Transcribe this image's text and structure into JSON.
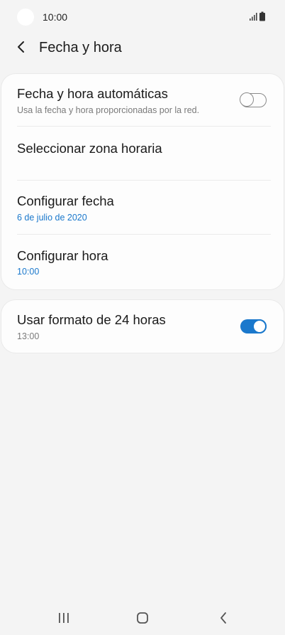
{
  "status_bar": {
    "time": "10:00",
    "icons": [
      "signal-icon",
      "battery-icon"
    ]
  },
  "app_bar": {
    "title": "Fecha y hora",
    "back_icon": "chevron-left-icon"
  },
  "settings": {
    "auto": {
      "title": "Fecha y hora automáticas",
      "subtitle": "Usa la fecha y hora proporcionadas por la red.",
      "enabled": false
    },
    "timezone": {
      "title": "Seleccionar zona horaria"
    },
    "date": {
      "title": "Configurar fecha",
      "value": "6 de julio de 2020"
    },
    "time": {
      "title": "Configurar hora",
      "value": "10:00"
    },
    "format24": {
      "title": "Usar formato de 24 horas",
      "subtitle": "13:00",
      "enabled": true
    }
  },
  "colors": {
    "accent": "#1a78cc",
    "background": "#f4f4f4",
    "card": "#fdfdfd"
  },
  "nav_bar": {
    "icons": [
      "recents-icon",
      "home-icon",
      "back-icon"
    ]
  }
}
